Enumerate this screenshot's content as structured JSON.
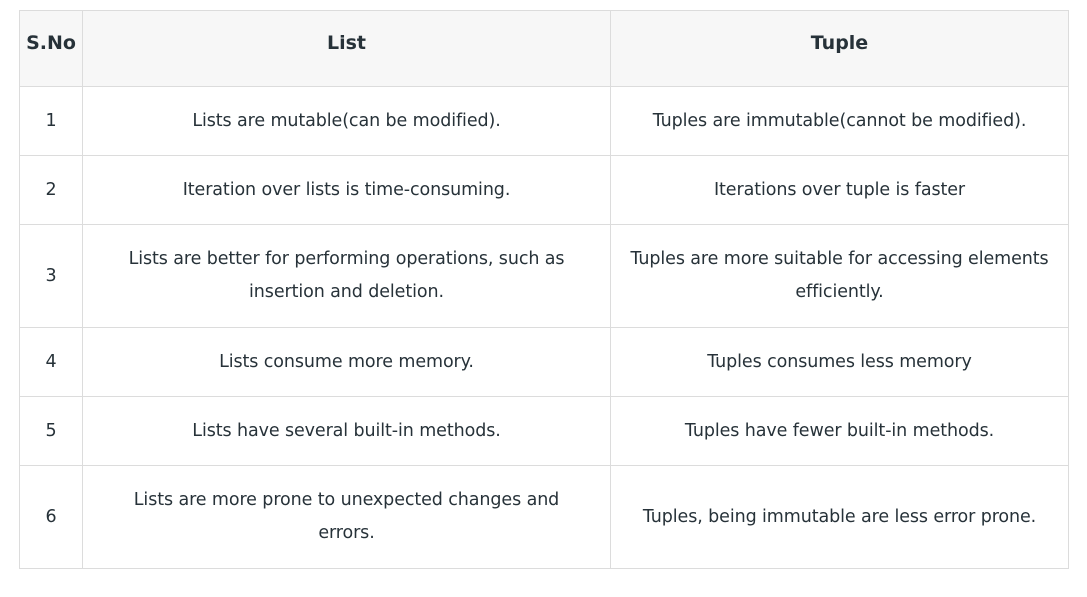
{
  "table": {
    "headers": [
      "S.No",
      "List",
      "Tuple"
    ],
    "rows": [
      {
        "sno": "1",
        "list": "Lists are mutable(can be modified).",
        "tuple": "Tuples are immutable(cannot be modified)."
      },
      {
        "sno": "2",
        "list": "Iteration over lists is time-consuming.",
        "tuple": "Iterations over tuple is faster"
      },
      {
        "sno": "3",
        "list": "Lists are better for performing operations, such as insertion and deletion.",
        "tuple": "Tuples are more suitable for accessing elements efficiently."
      },
      {
        "sno": "4",
        "list": "Lists consume more memory.",
        "tuple": "Tuples consumes less memory"
      },
      {
        "sno": "5",
        "list": "Lists have several built-in methods.",
        "tuple": "Tuples have fewer built-in methods."
      },
      {
        "sno": "6",
        "list": "Lists are more prone to unexpected changes and errors.",
        "tuple": "Tuples, being immutable are less error prone."
      }
    ]
  }
}
